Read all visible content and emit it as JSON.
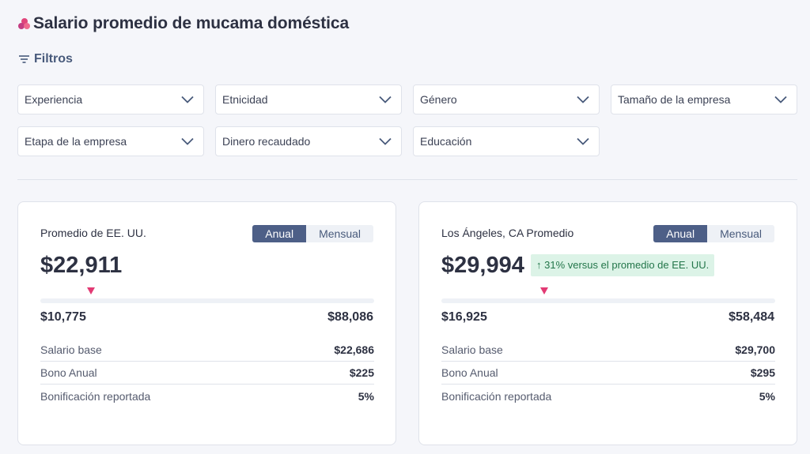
{
  "page": {
    "title": "Salario promedio de mucama doméstica"
  },
  "filters": {
    "toggle_label": "Filtros",
    "selects": [
      "Experiencia",
      "Etnicidad",
      "Género",
      "Tamaño de la empresa",
      "Etapa de la empresa",
      "Dinero recaudado",
      "Educación"
    ]
  },
  "cards": [
    {
      "title": "Promedio de EE. UU.",
      "toggle": {
        "annual": "Anual",
        "monthly": "Mensual",
        "selected": "Anual"
      },
      "average": "$22,911",
      "comparison": "",
      "range_min": "$10,775",
      "range_max": "$88,086",
      "rows": [
        {
          "label": "Salario base",
          "value": "$22,686"
        },
        {
          "label": "Bono Anual",
          "value": "$225"
        },
        {
          "label": "Bonificación reportada",
          "value": "5%"
        }
      ]
    },
    {
      "title": "Los Ángeles, CA Promedio",
      "toggle": {
        "annual": "Anual",
        "monthly": "Mensual",
        "selected": "Anual"
      },
      "average": "$29,994",
      "comparison": "↑ 31% versus el promedio de EE. UU.",
      "range_min": "$16,925",
      "range_max": "$58,484",
      "rows": [
        {
          "label": "Salario base",
          "value": "$29,700"
        },
        {
          "label": "Bono Anual",
          "value": "$295"
        },
        {
          "label": "Bonificación reportada",
          "value": "5%"
        }
      ]
    }
  ],
  "colors": {
    "accent": "#4d5f87",
    "marker": "#e23a74",
    "positive_bg": "#dcf3e7",
    "positive_text": "#23764a"
  },
  "icons": [
    "brand-logo-icon",
    "filter-icon",
    "chevron-down-icon",
    "marker-triangle-icon",
    "arrow-up-icon"
  ]
}
